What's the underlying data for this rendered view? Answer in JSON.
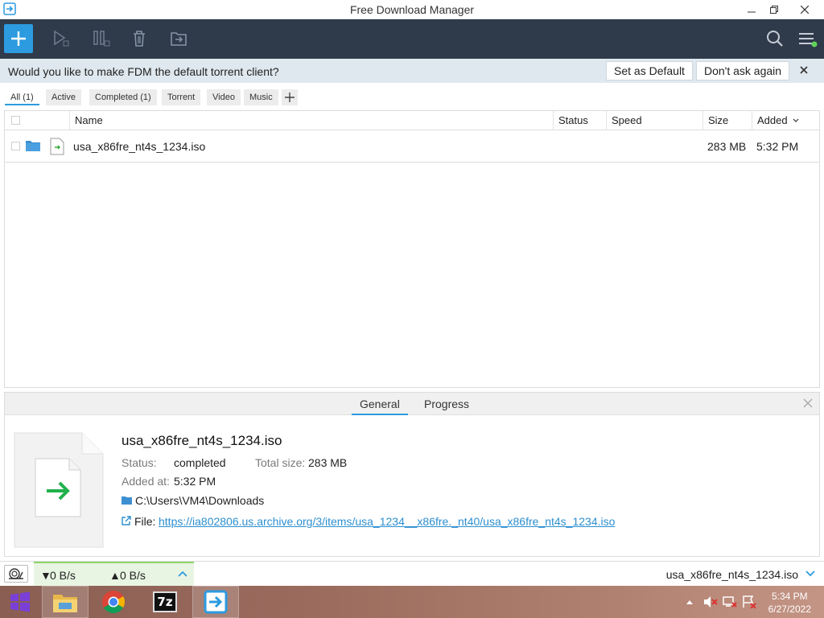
{
  "window": {
    "title": "Free Download Manager"
  },
  "notice": {
    "message": "Would you like to make FDM the default torrent client?",
    "set_default": "Set as Default",
    "dont_ask": "Don't ask again"
  },
  "filters": [
    {
      "label": "All (1)",
      "active": true
    },
    {
      "label": "Active",
      "active": false
    },
    {
      "label": "Completed (1)",
      "active": false
    },
    {
      "label": "Torrent",
      "active": false
    },
    {
      "label": "Video",
      "active": false
    },
    {
      "label": "Music",
      "active": false
    }
  ],
  "table": {
    "columns": {
      "name": "Name",
      "status": "Status",
      "speed": "Speed",
      "size": "Size",
      "added": "Added"
    },
    "rows": [
      {
        "name": "usa_x86fre_nt4s_1234.iso",
        "status": "",
        "speed": "",
        "size": "283 MB",
        "added": "5:32 PM"
      }
    ]
  },
  "details": {
    "tabs": [
      "General",
      "Progress"
    ],
    "file_name": "usa_x86fre_nt4s_1234.iso",
    "status_label": "Status:",
    "status_value": "completed",
    "total_label": "Total size:",
    "total_value": "283 MB",
    "added_label": "Added at:",
    "added_value": "5:32 PM",
    "folder": "C:\\Users\\VM4\\Downloads",
    "file_label": "File:",
    "file_url": "https://ia802806.us.archive.org/3/items/usa_1234__x86fre._nt40/usa_x86fre_nt4s_1234.iso"
  },
  "statusbar": {
    "down_speed": "0 B/s",
    "up_speed": "0 B/s",
    "current_file": "usa_x86fre_nt4s_1234.iso"
  },
  "taskbar": {
    "time": "5:34 PM",
    "date": "6/27/2022",
    "sevenzip_label": "7z"
  },
  "colors": {
    "toolbar_bg": "#2f3a4a",
    "accent": "#2c9be0",
    "notice_bg": "#dfe8ee",
    "link": "#2c8fd0"
  }
}
